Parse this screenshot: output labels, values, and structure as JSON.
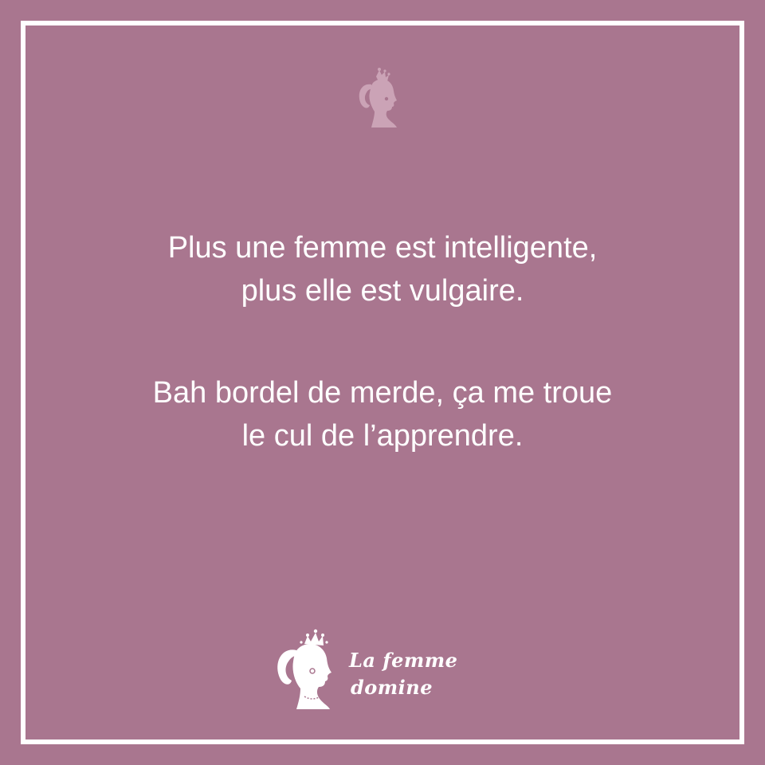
{
  "colors": {
    "background": "#a9768f",
    "frame": "#ffffff",
    "text": "#ffffff"
  },
  "icons": {
    "top": "woman-silhouette-crown-icon",
    "logo": "woman-silhouette-crown-icon"
  },
  "quote": {
    "paragraph1": [
      "Plus une femme est intelligente,",
      "plus elle est vulgaire."
    ],
    "paragraph2": [
      "Bah bordel de merde, ça me troue",
      "le cul de l’apprendre."
    ]
  },
  "brand": {
    "line1": "La femme",
    "line2": "domine"
  }
}
